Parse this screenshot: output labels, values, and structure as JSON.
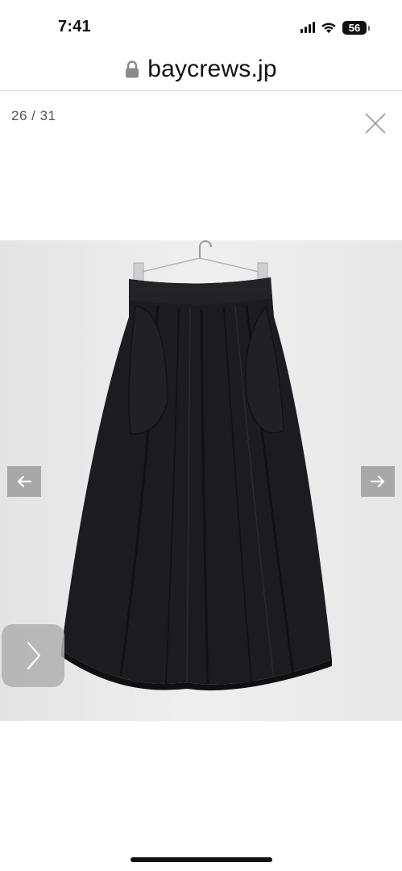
{
  "status_bar": {
    "time": "7:41",
    "battery": "56",
    "icons": [
      "signal-icon",
      "wifi-icon",
      "battery-icon"
    ]
  },
  "browser": {
    "url": "baycrews.jp",
    "icon": "lock-icon"
  },
  "gallery": {
    "counter": "26 / 31",
    "close_icon": "close-icon",
    "prev_icon": "arrow-left-icon",
    "next_icon": "arrow-right-icon",
    "float_next_icon": "chevron-right-icon",
    "image_subject": "black gathered midi skirt on hanger"
  },
  "colors": {
    "nav_button": "#a8a8a8",
    "image_background": "#ededed",
    "skirt": "#1c1c20"
  }
}
